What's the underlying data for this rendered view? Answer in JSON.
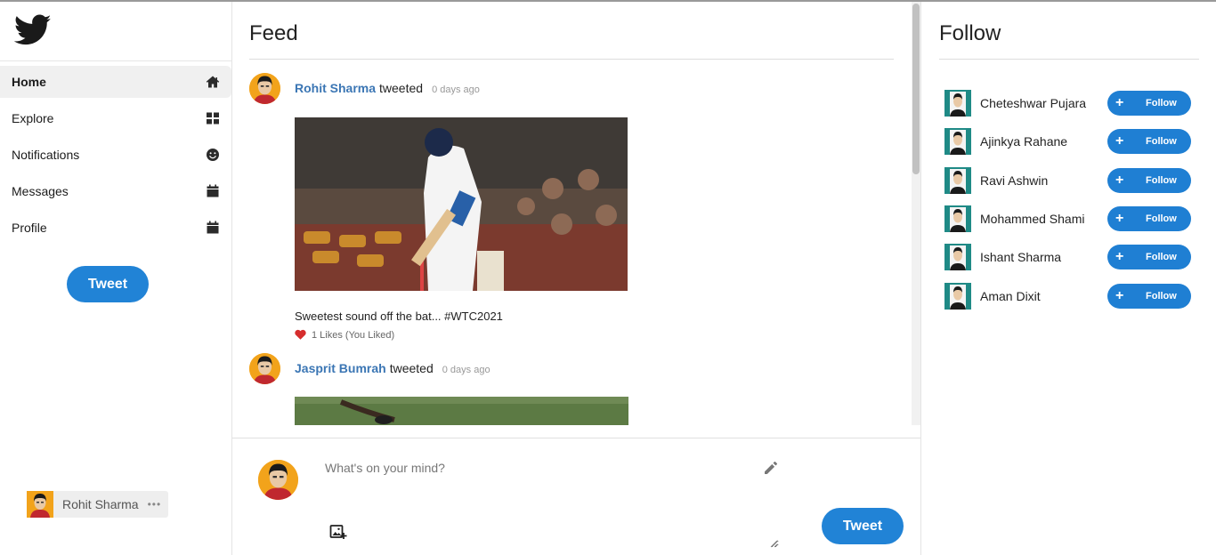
{
  "sidebar": {
    "items": [
      {
        "label": "Home",
        "icon": "home-icon"
      },
      {
        "label": "Explore",
        "icon": "grid-icon"
      },
      {
        "label": "Notifications",
        "icon": "smile-icon"
      },
      {
        "label": "Messages",
        "icon": "calendar-icon"
      },
      {
        "label": "Profile",
        "icon": "calendar-icon"
      }
    ],
    "tweet_button": "Tweet",
    "user": {
      "name": "Rohit Sharma",
      "more": "•••"
    }
  },
  "feed": {
    "title": "Feed",
    "posts": [
      {
        "author": "Rohit Sharma",
        "verb": "tweeted",
        "time": "0 days ago",
        "text": "Sweetest sound off the bat... #WTC2021",
        "likes": "1 Likes (You Liked)"
      },
      {
        "author": "Jasprit Bumrah",
        "verb": "tweeted",
        "time": "0 days ago"
      }
    ]
  },
  "composer": {
    "placeholder": "What's on your mind?",
    "tweet_button": "Tweet"
  },
  "follow": {
    "title": "Follow",
    "button_label": "Follow",
    "people": [
      {
        "name": "Cheteshwar Pujara"
      },
      {
        "name": "Ajinkya Rahane"
      },
      {
        "name": "Ravi Ashwin"
      },
      {
        "name": "Mohammed Shami"
      },
      {
        "name": "Ishant Sharma"
      },
      {
        "name": "Aman Dixit"
      }
    ]
  },
  "colors": {
    "accent": "#2183d6",
    "author_link": "#3b76b4",
    "like_heart": "#d62d2d"
  }
}
